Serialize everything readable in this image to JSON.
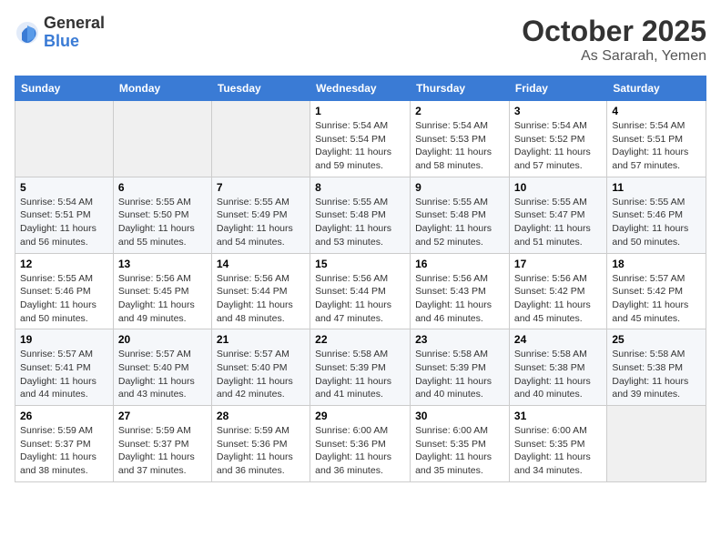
{
  "header": {
    "logo_general": "General",
    "logo_blue": "Blue",
    "month": "October 2025",
    "location": "As Sararah, Yemen"
  },
  "days_of_week": [
    "Sunday",
    "Monday",
    "Tuesday",
    "Wednesday",
    "Thursday",
    "Friday",
    "Saturday"
  ],
  "weeks": [
    [
      {
        "day": "",
        "info": ""
      },
      {
        "day": "",
        "info": ""
      },
      {
        "day": "",
        "info": ""
      },
      {
        "day": "1",
        "info": "Sunrise: 5:54 AM\nSunset: 5:54 PM\nDaylight: 11 hours and 59 minutes."
      },
      {
        "day": "2",
        "info": "Sunrise: 5:54 AM\nSunset: 5:53 PM\nDaylight: 11 hours and 58 minutes."
      },
      {
        "day": "3",
        "info": "Sunrise: 5:54 AM\nSunset: 5:52 PM\nDaylight: 11 hours and 57 minutes."
      },
      {
        "day": "4",
        "info": "Sunrise: 5:54 AM\nSunset: 5:51 PM\nDaylight: 11 hours and 57 minutes."
      }
    ],
    [
      {
        "day": "5",
        "info": "Sunrise: 5:54 AM\nSunset: 5:51 PM\nDaylight: 11 hours and 56 minutes."
      },
      {
        "day": "6",
        "info": "Sunrise: 5:55 AM\nSunset: 5:50 PM\nDaylight: 11 hours and 55 minutes."
      },
      {
        "day": "7",
        "info": "Sunrise: 5:55 AM\nSunset: 5:49 PM\nDaylight: 11 hours and 54 minutes."
      },
      {
        "day": "8",
        "info": "Sunrise: 5:55 AM\nSunset: 5:48 PM\nDaylight: 11 hours and 53 minutes."
      },
      {
        "day": "9",
        "info": "Sunrise: 5:55 AM\nSunset: 5:48 PM\nDaylight: 11 hours and 52 minutes."
      },
      {
        "day": "10",
        "info": "Sunrise: 5:55 AM\nSunset: 5:47 PM\nDaylight: 11 hours and 51 minutes."
      },
      {
        "day": "11",
        "info": "Sunrise: 5:55 AM\nSunset: 5:46 PM\nDaylight: 11 hours and 50 minutes."
      }
    ],
    [
      {
        "day": "12",
        "info": "Sunrise: 5:55 AM\nSunset: 5:46 PM\nDaylight: 11 hours and 50 minutes."
      },
      {
        "day": "13",
        "info": "Sunrise: 5:56 AM\nSunset: 5:45 PM\nDaylight: 11 hours and 49 minutes."
      },
      {
        "day": "14",
        "info": "Sunrise: 5:56 AM\nSunset: 5:44 PM\nDaylight: 11 hours and 48 minutes."
      },
      {
        "day": "15",
        "info": "Sunrise: 5:56 AM\nSunset: 5:44 PM\nDaylight: 11 hours and 47 minutes."
      },
      {
        "day": "16",
        "info": "Sunrise: 5:56 AM\nSunset: 5:43 PM\nDaylight: 11 hours and 46 minutes."
      },
      {
        "day": "17",
        "info": "Sunrise: 5:56 AM\nSunset: 5:42 PM\nDaylight: 11 hours and 45 minutes."
      },
      {
        "day": "18",
        "info": "Sunrise: 5:57 AM\nSunset: 5:42 PM\nDaylight: 11 hours and 45 minutes."
      }
    ],
    [
      {
        "day": "19",
        "info": "Sunrise: 5:57 AM\nSunset: 5:41 PM\nDaylight: 11 hours and 44 minutes."
      },
      {
        "day": "20",
        "info": "Sunrise: 5:57 AM\nSunset: 5:40 PM\nDaylight: 11 hours and 43 minutes."
      },
      {
        "day": "21",
        "info": "Sunrise: 5:57 AM\nSunset: 5:40 PM\nDaylight: 11 hours and 42 minutes."
      },
      {
        "day": "22",
        "info": "Sunrise: 5:58 AM\nSunset: 5:39 PM\nDaylight: 11 hours and 41 minutes."
      },
      {
        "day": "23",
        "info": "Sunrise: 5:58 AM\nSunset: 5:39 PM\nDaylight: 11 hours and 40 minutes."
      },
      {
        "day": "24",
        "info": "Sunrise: 5:58 AM\nSunset: 5:38 PM\nDaylight: 11 hours and 40 minutes."
      },
      {
        "day": "25",
        "info": "Sunrise: 5:58 AM\nSunset: 5:38 PM\nDaylight: 11 hours and 39 minutes."
      }
    ],
    [
      {
        "day": "26",
        "info": "Sunrise: 5:59 AM\nSunset: 5:37 PM\nDaylight: 11 hours and 38 minutes."
      },
      {
        "day": "27",
        "info": "Sunrise: 5:59 AM\nSunset: 5:37 PM\nDaylight: 11 hours and 37 minutes."
      },
      {
        "day": "28",
        "info": "Sunrise: 5:59 AM\nSunset: 5:36 PM\nDaylight: 11 hours and 36 minutes."
      },
      {
        "day": "29",
        "info": "Sunrise: 6:00 AM\nSunset: 5:36 PM\nDaylight: 11 hours and 36 minutes."
      },
      {
        "day": "30",
        "info": "Sunrise: 6:00 AM\nSunset: 5:35 PM\nDaylight: 11 hours and 35 minutes."
      },
      {
        "day": "31",
        "info": "Sunrise: 6:00 AM\nSunset: 5:35 PM\nDaylight: 11 hours and 34 minutes."
      },
      {
        "day": "",
        "info": ""
      }
    ]
  ]
}
